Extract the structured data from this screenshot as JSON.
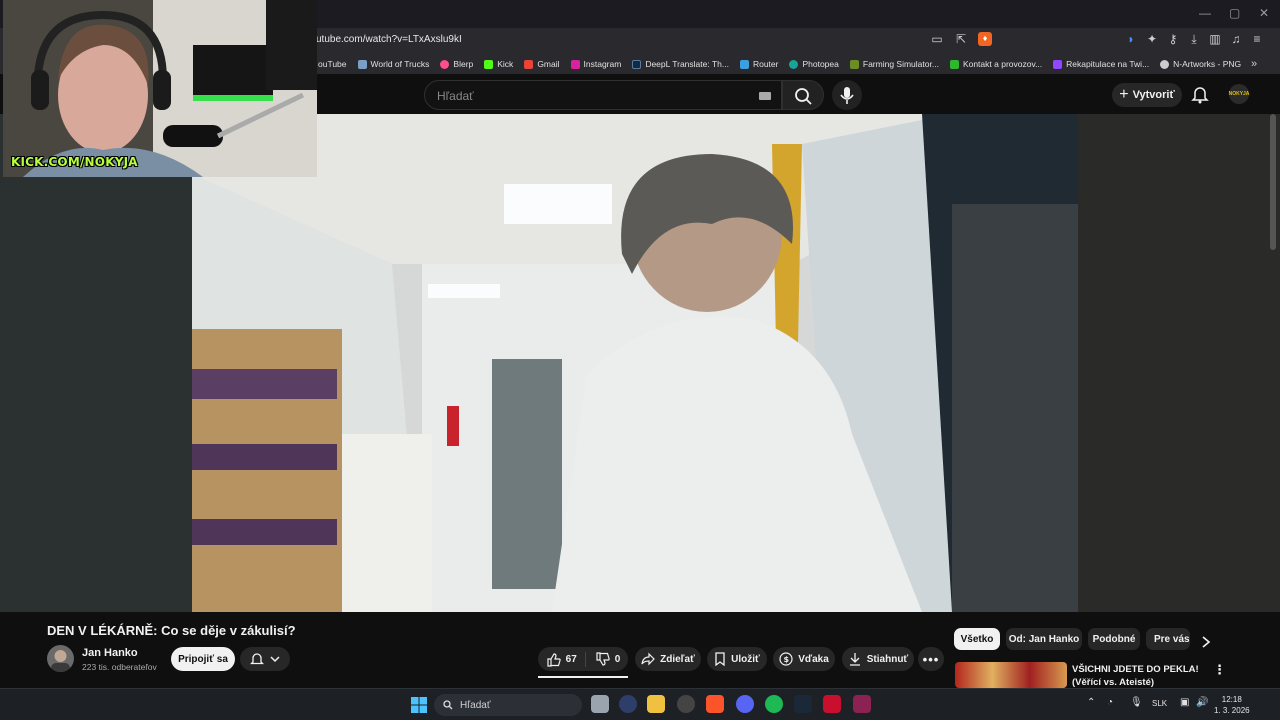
{
  "browser": {
    "url": "utube.com/watch?v=LTxAxslu9kI",
    "bookmarks": [
      {
        "label": "ouTube",
        "color": "#ff0000"
      },
      {
        "label": "World of Trucks",
        "color": "#7aa0c8"
      },
      {
        "label": "Blerp",
        "color": "#ff4f8b"
      },
      {
        "label": "Kick",
        "color": "#53fc18"
      },
      {
        "label": "Gmail",
        "color": "#ea4335"
      },
      {
        "label": "Instagram",
        "color": "#d6249f"
      },
      {
        "label": "DeepL Translate: Th...",
        "color": "#0f2b46"
      },
      {
        "label": "Router",
        "color": "#3aa0e0"
      },
      {
        "label": "Photopea",
        "color": "#18a497"
      },
      {
        "label": "Farming Simulator...",
        "color": "#6b8e23"
      },
      {
        "label": "Kontakt a provozov...",
        "color": "#2eb82e"
      },
      {
        "label": "Rekapitulace na Twi...",
        "color": "#9146ff"
      },
      {
        "label": "N-Artworks - PNG",
        "color": "#cccccc"
      }
    ]
  },
  "youtube": {
    "search_placeholder": "Hľadať",
    "create_label": "Vytvoriť",
    "avatar_text": "NOKYJA"
  },
  "video": {
    "title": "DEN V LÉKÁRNĚ: Co se děje v zákulisí?",
    "channel_name": "Jan Hanko",
    "subscribers": "223 tis. odberateľov",
    "join_label": "Pripojiť sa",
    "likes": "67",
    "dislikes": "0",
    "share_label": "Zdieľať",
    "save_label": "Uložiť",
    "thanks_label": "Vďaka",
    "download_label": "Stiahnuť"
  },
  "chips": [
    "Všetko",
    "Od: Jan Hanko",
    "Podobné",
    "Pre vás"
  ],
  "recommended": {
    "title_line1": "VŠICHNI JDETE DO PEKLA!",
    "title_line2": "(Věřící vs. Ateisté)"
  },
  "webcam": {
    "label": "KICK.COM/NOKYJA"
  },
  "taskbar": {
    "search_placeholder": "Hľadať",
    "language": "SLK",
    "time": "12:18",
    "date": "1. 3. 2026"
  },
  "colors": {
    "accent_kick": "#53fc18",
    "youtube_bg": "#0f0f0f",
    "chip_bg": "#272727"
  }
}
